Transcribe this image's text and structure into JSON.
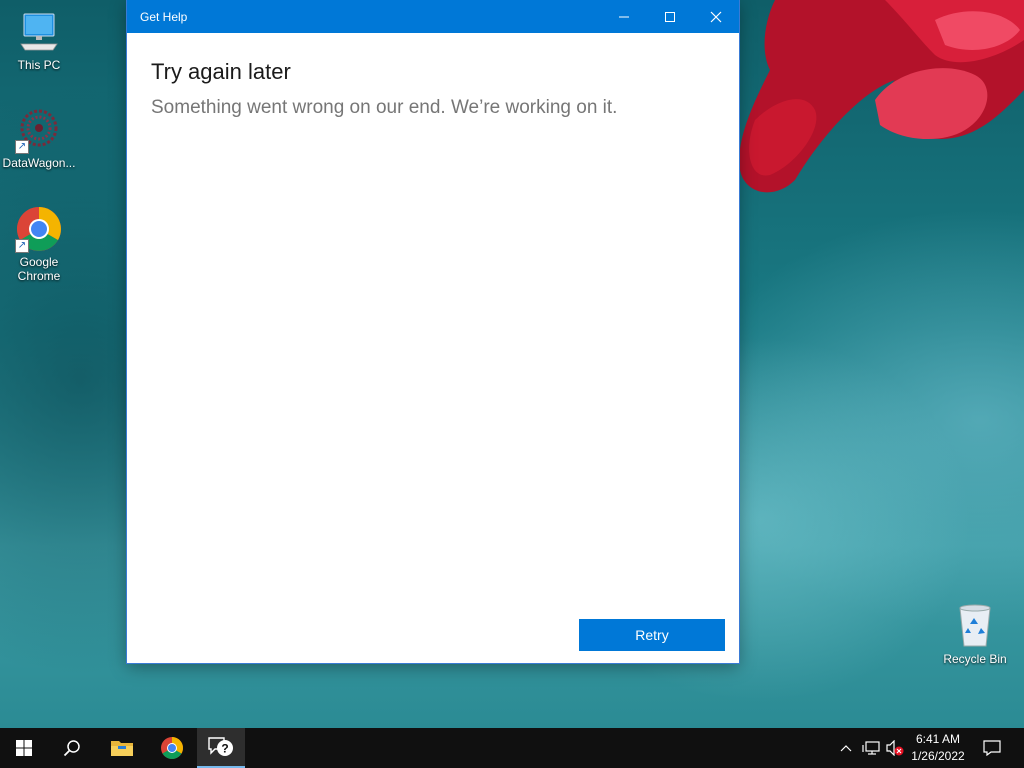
{
  "desktop": {
    "icons": [
      {
        "label": "This PC",
        "icon": "computer-icon"
      },
      {
        "label": "DataWagon...",
        "icon": "datawagon-icon"
      },
      {
        "label": "Google Chrome",
        "icon": "chrome-icon"
      },
      {
        "label": "Recycle Bin",
        "icon": "recycle-bin-icon"
      }
    ]
  },
  "window": {
    "title": "Get Help",
    "heading": "Try again later",
    "message": "Something went wrong on our end. We’re working on it.",
    "retry_label": "Retry",
    "controls": [
      "minimize-icon",
      "maximize-icon",
      "close-icon"
    ],
    "accent_color": "#0078d7"
  },
  "taskbar": {
    "items": [
      "start-icon",
      "search-icon",
      "file-explorer-icon",
      "chrome-icon",
      "get-help-icon"
    ],
    "active_item": "get-help-icon",
    "tray": [
      "chevron-up-icon",
      "network-icon",
      "volume-muted-icon",
      "notification-icon"
    ],
    "time": "6:41 AM",
    "date": "1/26/2022"
  }
}
